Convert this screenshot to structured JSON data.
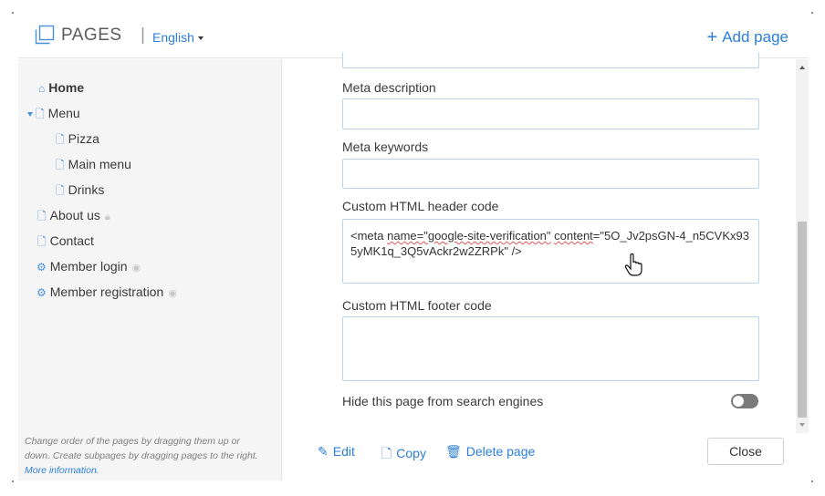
{
  "header": {
    "title": "PAGES",
    "separator": "|",
    "language": "English",
    "add_page": "Add page",
    "add_icon": "+"
  },
  "sidebar": {
    "items": [
      {
        "label": "Home",
        "icon": "home-icon"
      },
      {
        "label": "Menu",
        "icon": "page-icon"
      },
      {
        "label": "Pizza",
        "icon": "page-icon"
      },
      {
        "label": "Main menu",
        "icon": "page-icon"
      },
      {
        "label": "Drinks",
        "icon": "page-icon"
      },
      {
        "label": "About us",
        "icon": "page-icon",
        "suffix_icon": "lock-icon"
      },
      {
        "label": "Contact",
        "icon": "page-icon"
      },
      {
        "label": "Member login",
        "icon": "gear-icon",
        "suffix_icon": "eye-icon"
      },
      {
        "label": "Member registration",
        "icon": "gear-icon",
        "suffix_icon": "eye-icon"
      }
    ],
    "help_text": "Change order of the pages by dragging them up or down. Create subpages by dragging pages to the right.",
    "help_link": "More information."
  },
  "form": {
    "meta_description_label": "Meta description",
    "meta_description_value": "",
    "meta_keywords_label": "Meta keywords",
    "meta_keywords_value": "",
    "header_code_label": "Custom HTML header code",
    "header_code_value": "<meta name=\"google-site-verification\" content=\"5O_Jv2psGN-4_n5CVKx935yMK1q_3Q5vAckr2w2ZRPk\" />",
    "footer_code_label": "Custom HTML footer code",
    "footer_code_value": "",
    "hide_label": "Hide this page from search engines",
    "hide_enabled": false
  },
  "footer": {
    "edit": "Edit",
    "copy": "Copy",
    "delete": "Delete page",
    "close": "Close"
  },
  "colors": {
    "accent": "#2b7fd8",
    "field_border": "#b9d4ec",
    "toggle_off": "#7b7b7b"
  }
}
